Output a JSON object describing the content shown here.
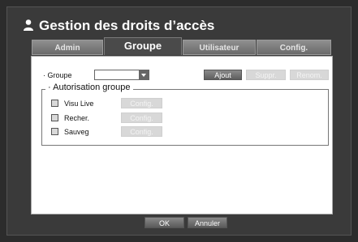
{
  "header": {
    "title": "Gestion des droits d’accès",
    "icon": "user-icon"
  },
  "tabs": [
    {
      "label": "Admin",
      "active": false
    },
    {
      "label": "Groupe",
      "active": true
    },
    {
      "label": "Utilisateur",
      "active": false
    },
    {
      "label": "Config.",
      "active": false
    }
  ],
  "groupe": {
    "label": "· Groupe",
    "select_value": "",
    "buttons": {
      "add": "Ajout",
      "delete": "Suppr.",
      "rename": "Renom."
    }
  },
  "autorisation": {
    "title": "· Autorisation groupe",
    "items": [
      {
        "label": "Visu Live",
        "config": "Config."
      },
      {
        "label": "Recher.",
        "config": "Config."
      },
      {
        "label": "Sauveg",
        "config": "Config."
      }
    ]
  },
  "footer": {
    "ok": "OK",
    "cancel": "Annuler"
  },
  "colors": {
    "tab_active": "#4a4a4a",
    "panel_bg": "#ffffff",
    "button_dark": "#6e6e6e",
    "button_disabled": "#d8d8d8"
  }
}
